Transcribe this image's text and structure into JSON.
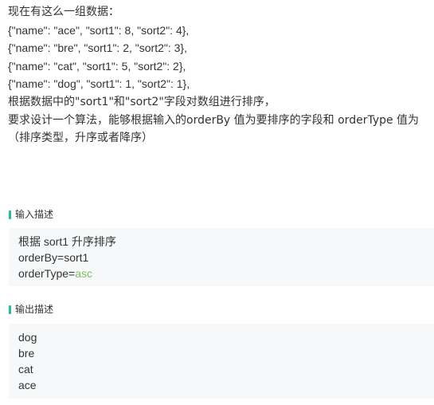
{
  "problem": {
    "intro": "现在有这么一组数据：",
    "data_lines": [
      "{\"name\": \"ace\", \"sort1\": 8, \"sort2\": 4},",
      "{\"name\": \"bre\", \"sort1\": 2, \"sort2\": 3},",
      "{\"name\": \"cat\", \"sort1\": 5, \"sort2\": 2},",
      "{\"name\": \"dog\", \"sort1\": 1, \"sort2\": 1},"
    ],
    "requirement_1": "根据数据中的\"sort1\"和\"sort2\"字段对数组进行排序，",
    "requirement_2": "要求设计一个算法，能够根据输入的orderBy 值为要排序的字段和 orderType 值为",
    "requirement_3": "（排序类型，升序或者降序）"
  },
  "input_section": {
    "title": "输入描述",
    "lines": [
      "根据 sort1 升序排序",
      "orderBy=sort1"
    ],
    "order_type_prefix": "orderType=",
    "order_type_value": "asc"
  },
  "output_section": {
    "title": "输出描述",
    "lines": [
      "dog",
      "bre",
      "cat",
      "ace"
    ]
  },
  "colors": {
    "accent": "#25bb9b",
    "keyword": "#7fbf64",
    "box_background": "#f7f8f9",
    "text": "#333333"
  }
}
